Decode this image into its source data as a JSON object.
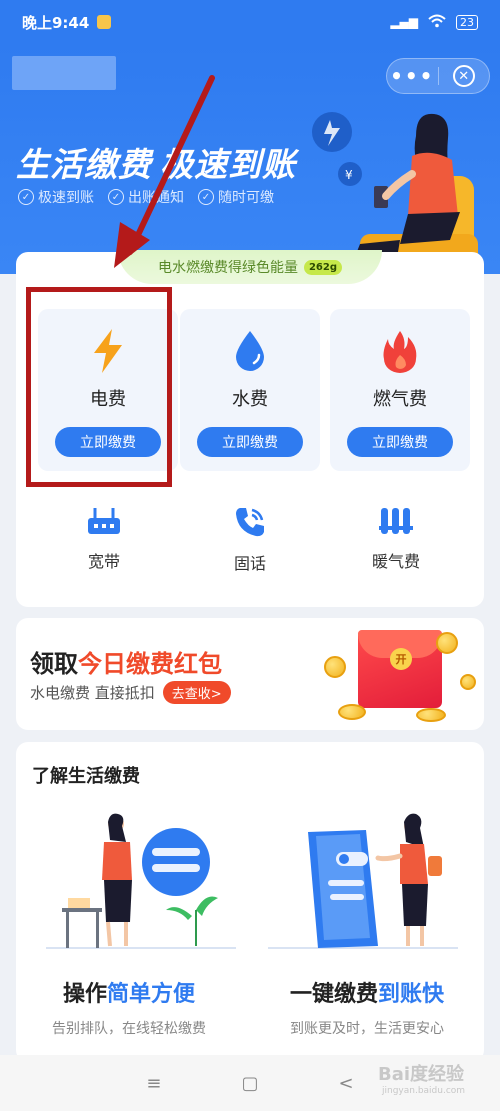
{
  "status": {
    "time": "晚上9:44",
    "battery": "23"
  },
  "hero": {
    "title_a": "生活缴费",
    "title_b": "极速到账",
    "features": [
      "极速到账",
      "出账通知",
      "随时可缴"
    ]
  },
  "green_banner": {
    "text": "电水燃缴费得绿色能量",
    "badge": "262g"
  },
  "main_tiles": [
    {
      "name": "电费",
      "button": "立即缴费"
    },
    {
      "name": "水费",
      "button": "立即缴费"
    },
    {
      "name": "燃气费",
      "button": "立即缴费"
    }
  ],
  "services": [
    {
      "label": "宽带"
    },
    {
      "label": "固话"
    },
    {
      "label": "暖气费"
    }
  ],
  "promo": {
    "title_a": "领取",
    "title_b": "今日缴费红包",
    "subtitle": "水电缴费 直接抵扣",
    "button": "去查收>",
    "seal": "开"
  },
  "info": {
    "title": "了解生活缴费",
    "cards": [
      {
        "caption_a": "操作",
        "caption_b": "简单方便",
        "desc": "告别排队，在线轻松缴费"
      },
      {
        "caption_a": "一键缴费",
        "caption_b": "到账快",
        "desc": "到账更及时，生活更安心"
      }
    ]
  },
  "nav": {
    "menu": "≡",
    "home": "▢",
    "back": "<"
  },
  "watermark": {
    "main": "Bai度经验",
    "sub": "jingyan.baidu.com"
  }
}
